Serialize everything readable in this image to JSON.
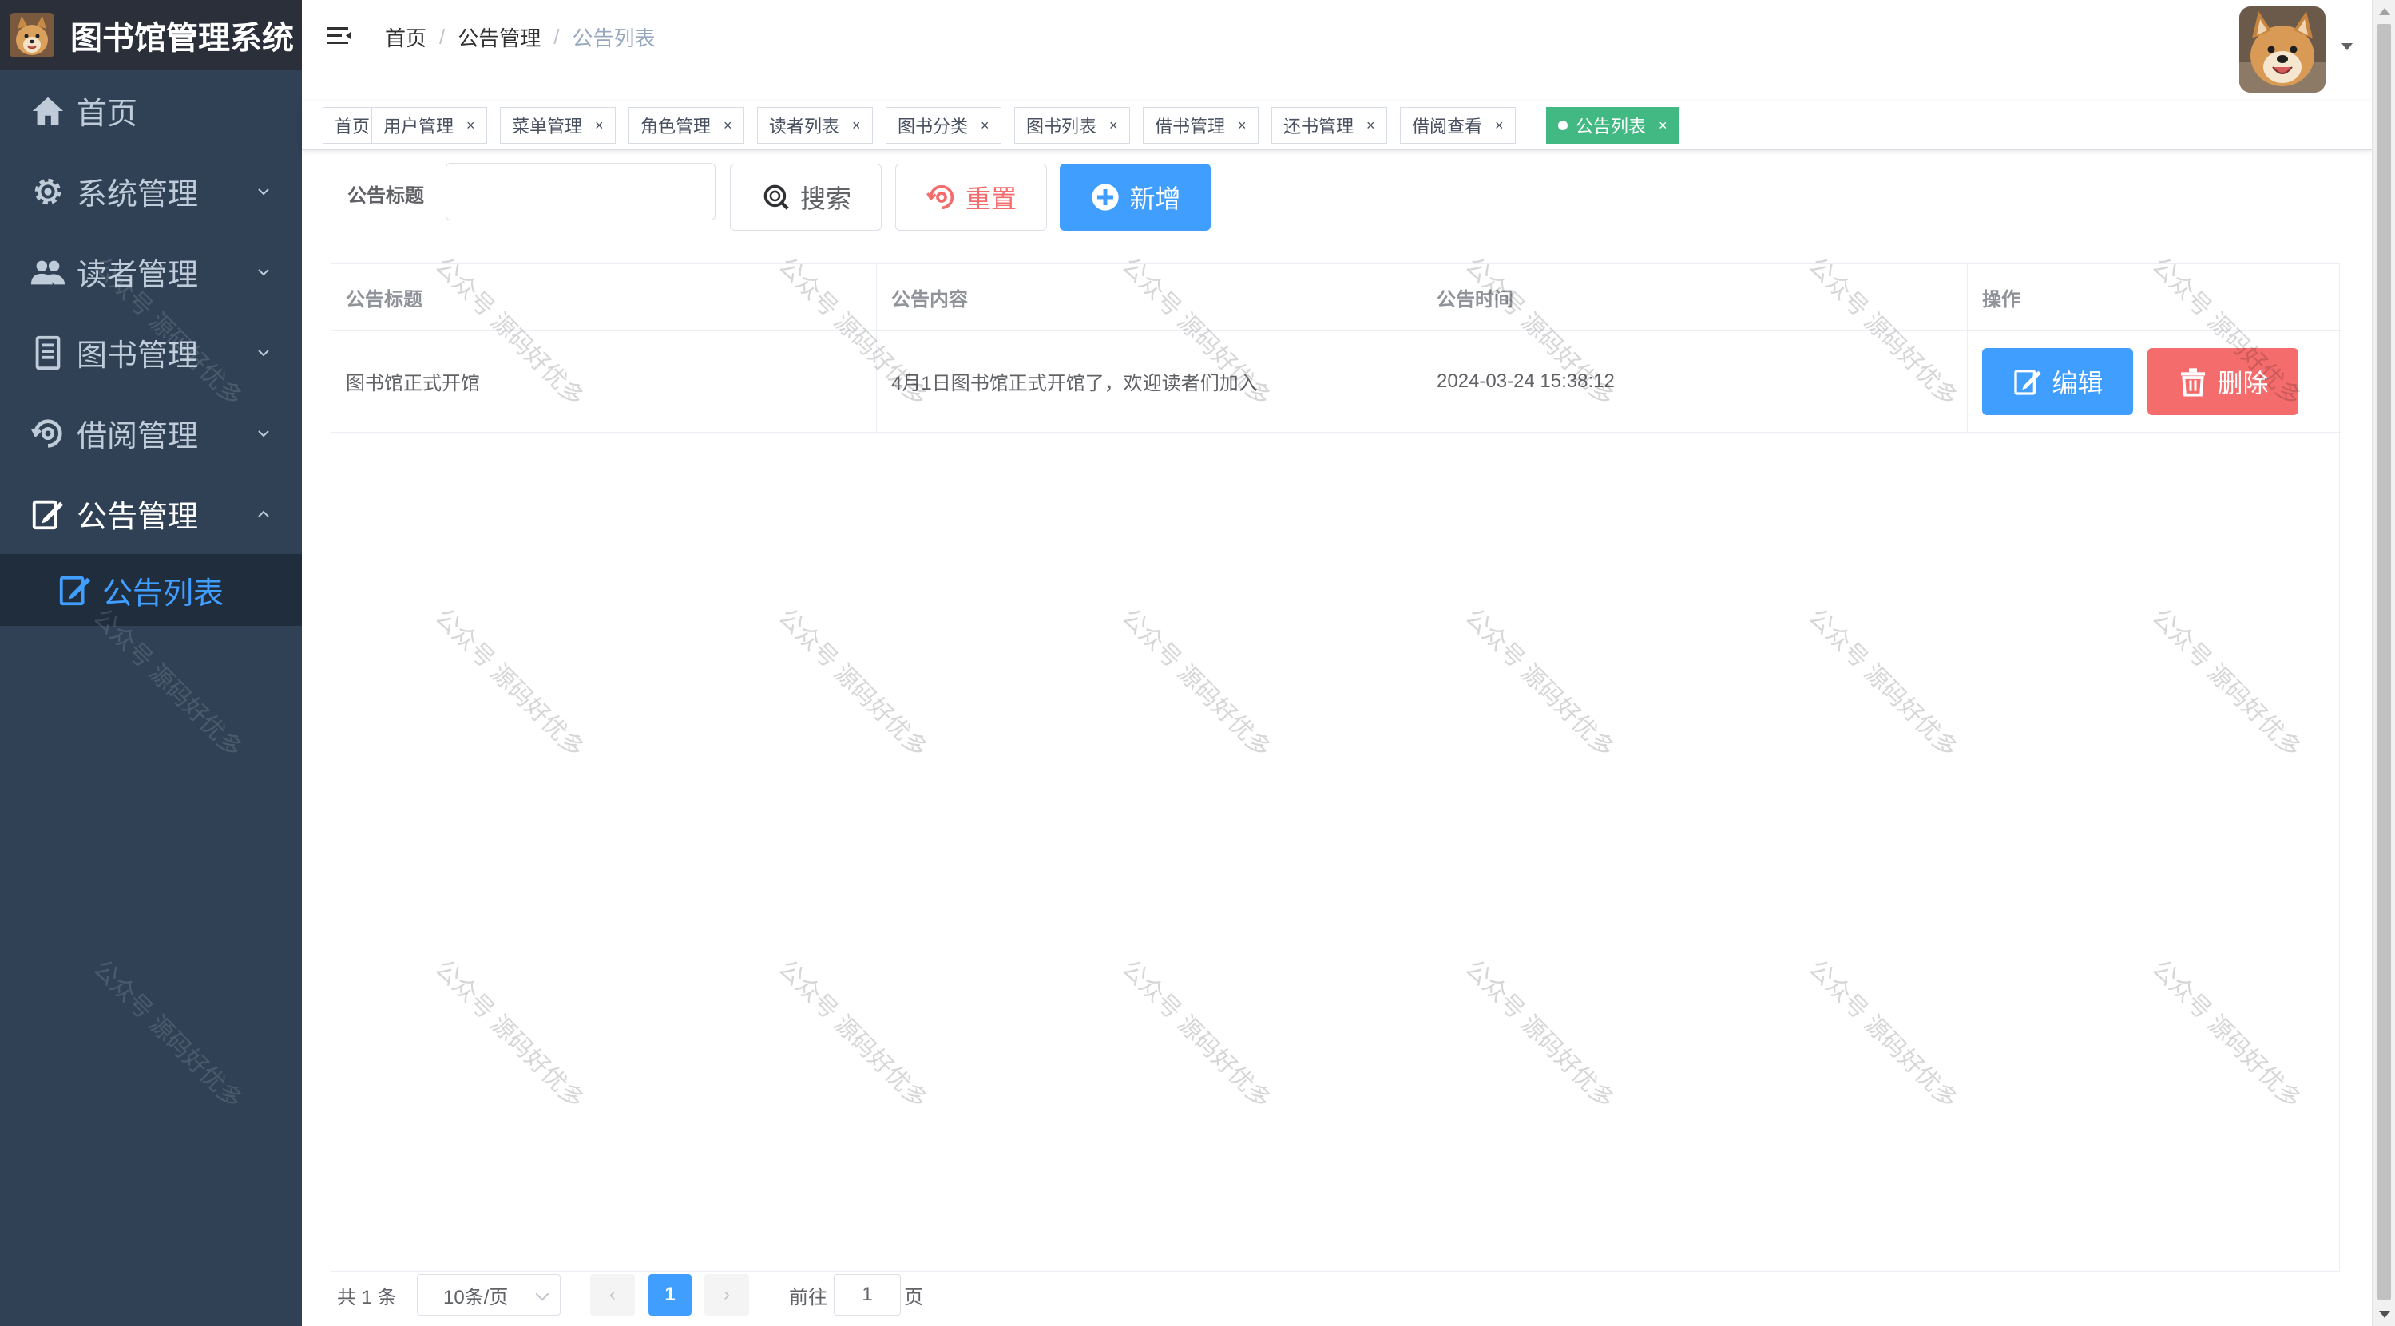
{
  "app": {
    "title": "图书馆管理系统"
  },
  "sidebar": {
    "items": [
      {
        "label": "首页",
        "icon": "home-icon"
      },
      {
        "label": "系统管理",
        "icon": "gear-icon",
        "expandable": true
      },
      {
        "label": "读者管理",
        "icon": "users-icon",
        "expandable": true
      },
      {
        "label": "图书管理",
        "icon": "book-icon",
        "expandable": true
      },
      {
        "label": "借阅管理",
        "icon": "borrow-icon",
        "expandable": true
      },
      {
        "label": "公告管理",
        "icon": "notice-icon",
        "expanded": true
      }
    ],
    "sub_items": [
      {
        "label": "公告列表",
        "icon": "edit-note-icon",
        "active": true
      }
    ]
  },
  "breadcrumb": [
    "首页",
    "公告管理",
    "公告列表"
  ],
  "tags": [
    {
      "label": "首页",
      "closable": false
    },
    {
      "label": "用户管理",
      "closable": true
    },
    {
      "label": "菜单管理",
      "closable": true
    },
    {
      "label": "角色管理",
      "closable": true
    },
    {
      "label": "读者列表",
      "closable": true
    },
    {
      "label": "图书分类",
      "closable": true
    },
    {
      "label": "图书列表",
      "closable": true
    },
    {
      "label": "借书管理",
      "closable": true
    },
    {
      "label": "还书管理",
      "closable": true
    },
    {
      "label": "借阅查看",
      "closable": true
    },
    {
      "label": "公告列表",
      "closable": true,
      "active": true
    }
  ],
  "tag_close": "×",
  "search": {
    "label": "公告标题",
    "value": "",
    "placeholder": "",
    "search_button": "搜索",
    "reset_button": "重置",
    "add_button": "新增"
  },
  "table": {
    "columns": [
      "公告标题",
      "公告内容",
      "公告时间",
      "操作"
    ],
    "rows": [
      {
        "title": "图书馆正式开馆",
        "content": "4月1日图书馆正式开馆了，欢迎读者们加入",
        "time": "2024-03-24 15:38:12"
      }
    ],
    "edit_button": "编辑",
    "delete_button": "删除"
  },
  "pagination": {
    "total_text": "共 1 条",
    "page_size": "10条/页",
    "current_page": "1",
    "goto_label": "前往",
    "goto_value": "1",
    "page_suffix": "页",
    "prev": "‹",
    "next": "›"
  },
  "watermark": "公众号 源码好优多",
  "colors": {
    "sidebar_bg": "#304156",
    "logo_bar_bg": "#2b2f3a",
    "submenu_bg": "#1f2d3d",
    "primary": "#409eff",
    "danger": "#f56c6c",
    "active_tag": "#42b983"
  }
}
